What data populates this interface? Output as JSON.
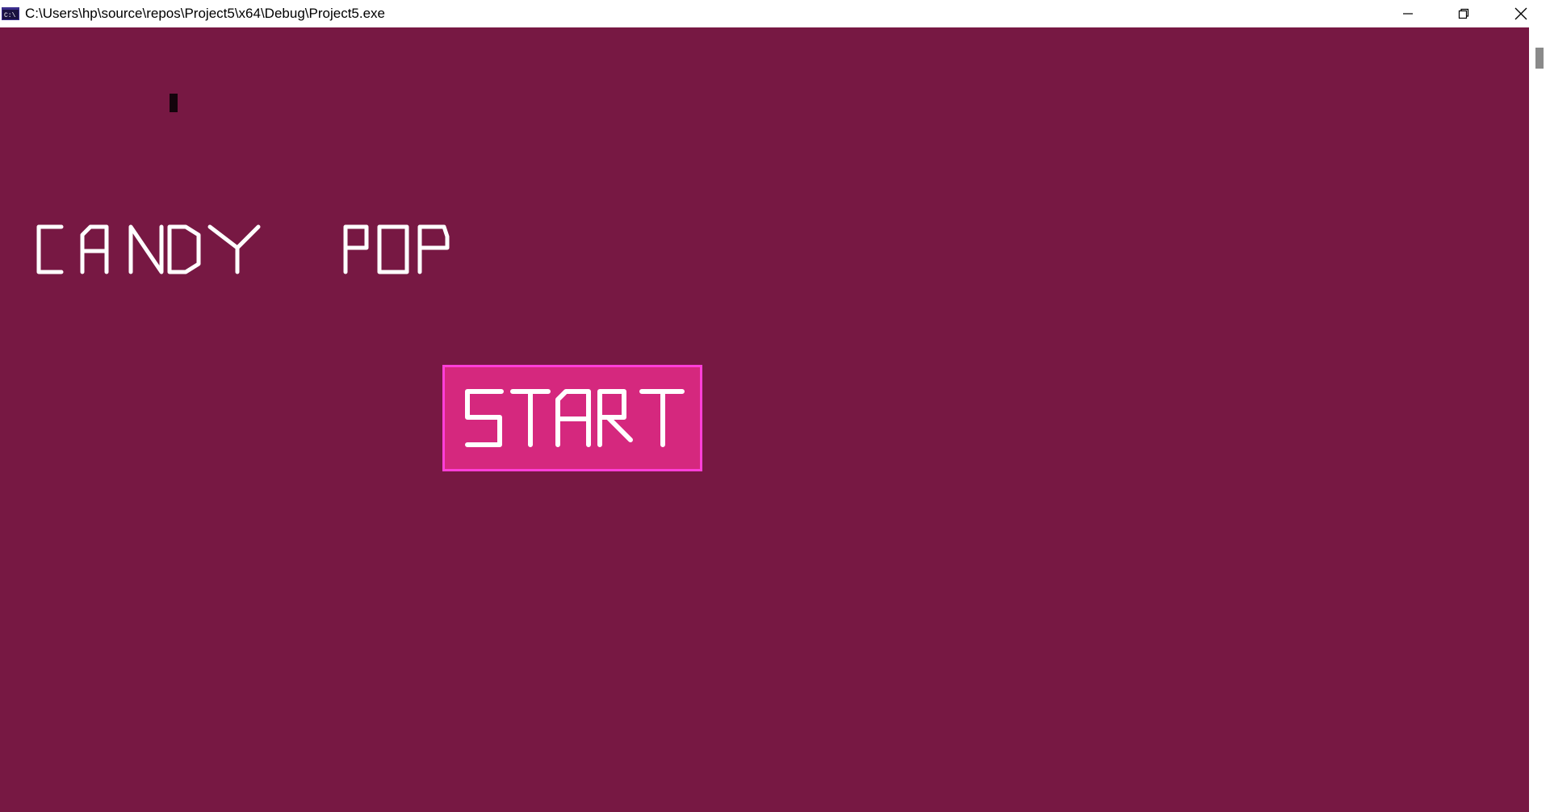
{
  "window": {
    "title": "C:\\Users\\hp\\source\\repos\\Project5\\x64\\Debug\\Project5.exe",
    "icon": "console-app-icon",
    "controls": [
      "minimize-icon",
      "restore-icon",
      "close-icon"
    ]
  },
  "game": {
    "title_word_1": "CANDY",
    "title_word_2": "POP",
    "start_label": "START"
  },
  "colors": {
    "background": "#771843",
    "button_fill": "#d5287e",
    "button_border": "#ff3fd8",
    "text": "#ffffff"
  }
}
